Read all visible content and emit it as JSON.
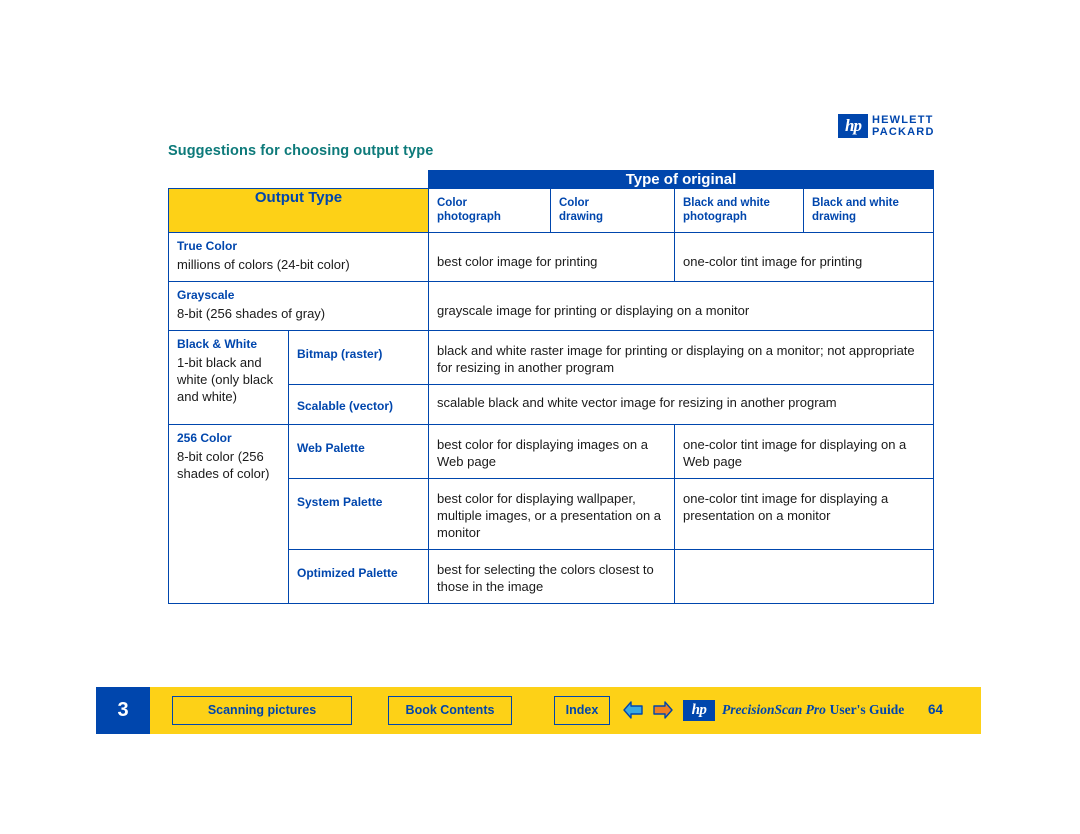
{
  "logo": {
    "mark": "hp",
    "line1": "HEWLETT",
    "line2": "PACKARD"
  },
  "heading": "Suggestions for choosing output type",
  "table": {
    "type_of_original_header": "Type of original",
    "output_type_header": "Output Type",
    "column_headers": [
      {
        "line1": "Color",
        "line2": "photograph"
      },
      {
        "line1": "Color",
        "line2": "drawing"
      },
      {
        "line1": "Black and white",
        "line2": "photograph"
      },
      {
        "line1": "Black and white",
        "line2": "drawing"
      }
    ],
    "rows": [
      {
        "name": "True Color",
        "desc": "millions of colors (24-bit color)",
        "cells": [
          "best color image for printing",
          "one-color tint image for printing"
        ]
      },
      {
        "name": "Grayscale",
        "desc": "8-bit (256 shades of gray)",
        "cells": [
          "grayscale image for printing or displaying on a monitor"
        ]
      },
      {
        "name": "Black & White",
        "desc": "1-bit black and white (only black and white)",
        "subrows": [
          {
            "label": "Bitmap (raster)",
            "text": "black and white raster image for printing or displaying on a monitor; not appropriate for resizing in another program"
          },
          {
            "label": "Scalable (vector)",
            "text": "scalable black and white vector image for resizing in another program"
          }
        ]
      },
      {
        "name": "256 Color",
        "desc": "8-bit color (256 shades of color)",
        "subrows": [
          {
            "label": "Web Palette",
            "cells": [
              "best color for displaying images on a Web page",
              "one-color tint image for displaying on a Web page"
            ]
          },
          {
            "label": "System Palette",
            "cells": [
              "best color for displaying wallpaper, multiple images, or a presentation on a monitor",
              "one-color tint image for displaying a presentation on a monitor"
            ]
          },
          {
            "label": "Optimized Palette",
            "cells": [
              "best for selecting the colors closest to those in the image",
              ""
            ]
          }
        ]
      }
    ]
  },
  "footer": {
    "chapter_number": "3",
    "scanning_button": "Scanning pictures",
    "contents_button": "Book Contents",
    "index_button": "Index",
    "hp_mark": "hp",
    "product": "PrecisionScan Pro",
    "guide": "User's Guide",
    "page_number": "64"
  },
  "colors": {
    "blue": "#0046ad",
    "yellow": "#fdd117",
    "teal": "#0d7a7a"
  }
}
